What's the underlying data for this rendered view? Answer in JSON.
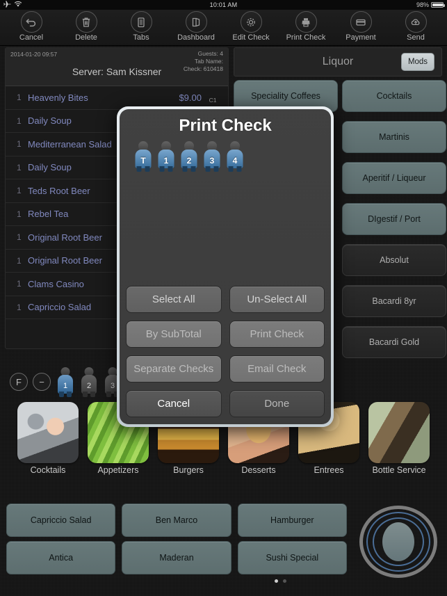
{
  "statusbar": {
    "airplane_icon": "airplane-icon",
    "wifi_icon": "wifi-icon",
    "time": "10:01 AM",
    "battery_percent": "98%"
  },
  "toolbar": {
    "items": [
      {
        "label": "Cancel",
        "icon": "undo-arrow-icon"
      },
      {
        "label": "Delete",
        "icon": "trash-icon"
      },
      {
        "label": "Tabs",
        "icon": "list-document-icon"
      },
      {
        "label": "Dashboard",
        "icon": "open-book-icon"
      },
      {
        "label": "Edit Check",
        "icon": "gear-icon"
      },
      {
        "label": "Print Check",
        "icon": "printer-icon"
      },
      {
        "label": "Payment",
        "icon": "credit-card-icon"
      },
      {
        "label": "Send",
        "icon": "cloud-upload-icon"
      }
    ]
  },
  "check": {
    "date": "2014-01-20 09:57",
    "server_label": "Server: Sam Kissner",
    "guests": "Guests: 4",
    "tab_name": "Tab Name:",
    "check_number": "Check: 610418",
    "lines": [
      {
        "qty": "1",
        "name": "Heavenly Bites",
        "price": "$9.00",
        "seat": "C1"
      },
      {
        "qty": "1",
        "name": "Daily Soup",
        "price": "",
        "seat": ""
      },
      {
        "qty": "1",
        "name": "Mediterranean Salad",
        "price": "",
        "seat": ""
      },
      {
        "qty": "1",
        "name": "Daily Soup",
        "price": "",
        "seat": ""
      },
      {
        "qty": "1",
        "name": "Teds Root Beer",
        "price": "",
        "seat": ""
      },
      {
        "qty": "1",
        "name": "Rebel Tea",
        "price": "",
        "seat": ""
      },
      {
        "qty": "1",
        "name": "Original Root Beer",
        "price": "",
        "seat": ""
      },
      {
        "qty": "1",
        "name": "Original Root Beer",
        "price": "",
        "seat": ""
      },
      {
        "qty": "1",
        "name": "Clams Casino",
        "price": "",
        "seat": ""
      },
      {
        "qty": "1",
        "name": "Capriccio Salad",
        "price": "",
        "seat": ""
      }
    ]
  },
  "guestbar": {
    "function_label": "F",
    "minus_label": "−",
    "seats": [
      {
        "label": "1",
        "selected": true
      },
      {
        "label": "2",
        "selected": false
      },
      {
        "label": "3",
        "selected": false
      }
    ]
  },
  "category_strip": [
    {
      "label": "Cocktails",
      "image": "cocktail-shaker-photo"
    },
    {
      "label": "Appetizers",
      "image": "lettuce-photo"
    },
    {
      "label": "Burgers",
      "image": "burger-photo"
    },
    {
      "label": "Desserts",
      "image": "pastry-photo"
    },
    {
      "label": "Entrees",
      "image": "woman-photo"
    },
    {
      "label": "Bottle Service",
      "image": "table-service-photo"
    }
  ],
  "bottom_items": [
    "Capriccio Salad",
    "Ben Marco",
    "Hamburger",
    "Antica",
    "Maderan",
    "Sushi Special"
  ],
  "pager": {
    "pages": 2,
    "active": 0
  },
  "dial": {
    "name": "jog-dial"
  },
  "right_panel": {
    "title": "Liquor",
    "mods_label": "Mods",
    "left_column": [
      {
        "label": "Speciality Coffees",
        "style": "teal"
      }
    ],
    "right_column": [
      {
        "label": "Cocktails",
        "style": "teal"
      },
      {
        "label": "Martinis",
        "style": "teal"
      },
      {
        "label": "Aperitif / Liqueur",
        "style": "teal"
      },
      {
        "label": "DIgestif / Port",
        "style": "teal"
      },
      {
        "label": "Absolut",
        "style": "dark"
      },
      {
        "label": "Bacardi 8yr",
        "style": "dark"
      },
      {
        "label": "Bacardi Gold",
        "style": "dark"
      }
    ]
  },
  "modal": {
    "title": "Print Check",
    "seats": [
      {
        "label": "T",
        "selected": true
      },
      {
        "label": "1",
        "selected": true
      },
      {
        "label": "2",
        "selected": true
      },
      {
        "label": "3",
        "selected": true
      },
      {
        "label": "4",
        "selected": true
      }
    ],
    "buttons": [
      {
        "label": "Select All",
        "state": "enabled"
      },
      {
        "label": "Un-Select All",
        "state": "enabled"
      },
      {
        "label": "By SubTotal",
        "state": "disabled"
      },
      {
        "label": "Print Check",
        "state": "disabled"
      },
      {
        "label": "Separate Checks",
        "state": "disabled"
      },
      {
        "label": "Email Check",
        "state": "disabled"
      },
      {
        "label": "Cancel",
        "state": "cancel"
      },
      {
        "label": "Done",
        "state": "done"
      }
    ]
  },
  "colors": {
    "accent_blue": "#4a7ca8",
    "teal_button": "#67797a",
    "panel_dark": "#1a1a1a",
    "modal_bg": "#3f3f3f"
  }
}
